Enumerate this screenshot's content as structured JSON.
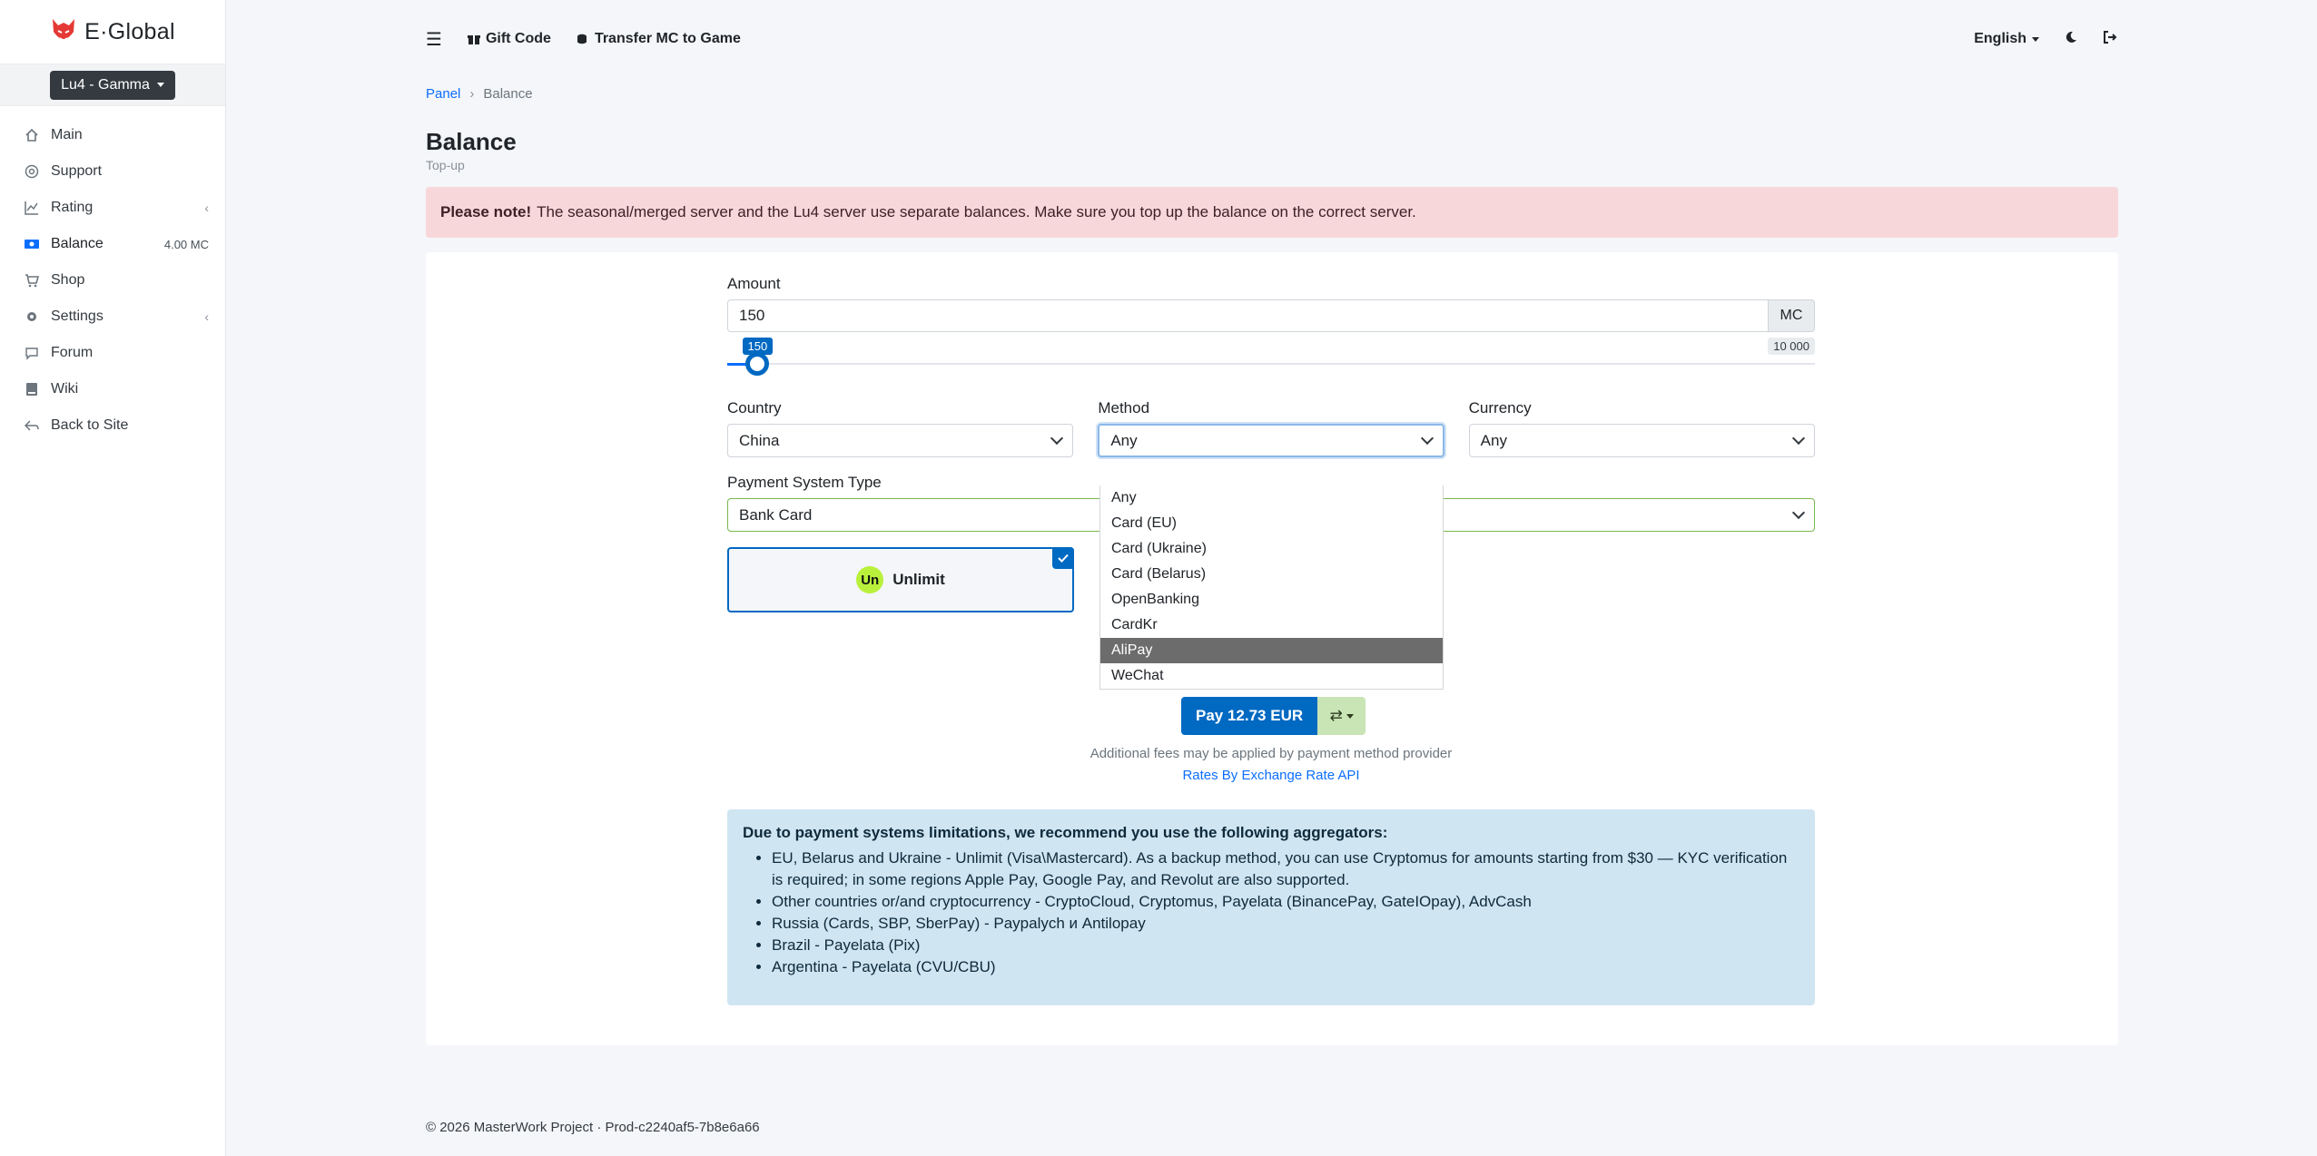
{
  "app": {
    "logo_text": "E·Global",
    "server_selector": "Lu4 - Gamma"
  },
  "sidebar": {
    "items": [
      {
        "label": "Main",
        "icon": "home-icon",
        "extra": ""
      },
      {
        "label": "Support",
        "icon": "lifebuoy-icon",
        "extra": ""
      },
      {
        "label": "Rating",
        "icon": "chart-line-icon",
        "extra": ""
      },
      {
        "label": "Balance",
        "icon": "money-icon",
        "extra": "4.00 MC"
      },
      {
        "label": "Shop",
        "icon": "cart-icon",
        "extra": ""
      },
      {
        "label": "Settings",
        "icon": "gear-icon",
        "extra": ""
      },
      {
        "label": "Forum",
        "icon": "comments-icon",
        "extra": ""
      },
      {
        "label": "Wiki",
        "icon": "book-icon",
        "extra": ""
      },
      {
        "label": "Back to Site",
        "icon": "back-arrow-icon",
        "extra": ""
      }
    ]
  },
  "topbar": {
    "gift_code": "Gift Code",
    "transfer": "Transfer MC to Game",
    "language": "English"
  },
  "breadcrumb": {
    "root": "Panel",
    "current": "Balance"
  },
  "page": {
    "title": "Balance",
    "subtitle": "Top-up"
  },
  "alert": {
    "strong": "Please note!",
    "text": "The seasonal/merged server and the Lu4 server use separate balances. Make sure you top up the balance on the correct server."
  },
  "form": {
    "amount_label": "Amount",
    "amount_value": "150",
    "amount_unit": "MC",
    "slider_value": 150,
    "slider_min_label": "150",
    "slider_max_label": "10 000",
    "country_label": "Country",
    "country_value": "China",
    "method_label": "Method",
    "method_value": "Any",
    "currency_label": "Currency",
    "currency_value": "Any",
    "pst_label": "Payment System Type",
    "pst_value": "Bank Card",
    "provider_name": "Unlimit",
    "provider_logo_text": "Un"
  },
  "method_options": [
    "Any",
    "Card (EU)",
    "Card (Ukraine)",
    "Card (Belarus)",
    "OpenBanking",
    "CardKr",
    "AliPay",
    "WeChat"
  ],
  "method_highlighted": "AliPay",
  "pay": {
    "label": "Pay 12.73 EUR",
    "fee_note": "Additional fees may be applied by payment method provider",
    "rates_link": "Rates By Exchange Rate API"
  },
  "info": {
    "title": "Due to payment systems limitations, we recommend you use the following aggregators:",
    "items": [
      "EU, Belarus and Ukraine - Unlimit (Visa\\Mastercard). As a backup method, you can use Cryptomus for amounts starting from $30 — KYC verification is required; in some regions Apple Pay, Google Pay, and Revolut are also supported.",
      "Other countries or/and cryptocurrency - CryptoCloud, Cryptomus, Payelata (BinancePay, GateIOpay), AdvCash",
      "Russia (Cards, SBP, SberPay) - Paypalych и Antilopay",
      "Brazil - Payelata (Pix)",
      "Argentina - Payelata (CVU/CBU)"
    ]
  },
  "footer": {
    "text": "© 2026 MasterWork Project · Prod-c2240af5-7b8e6a66"
  }
}
